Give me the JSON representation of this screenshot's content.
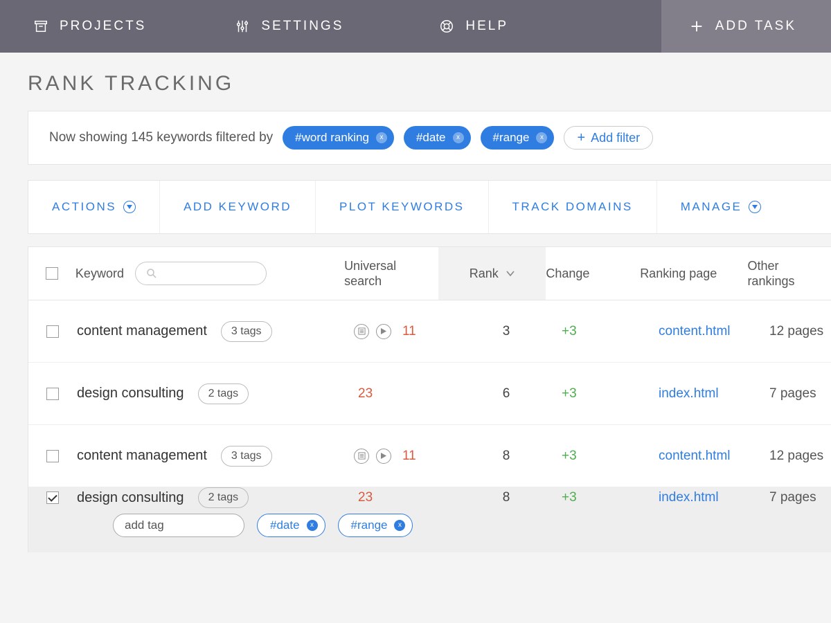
{
  "nav": {
    "projects": "PROJECTS",
    "settings": "SETTINGS",
    "help": "HELP",
    "add_task": "ADD TASK"
  },
  "page": {
    "title": "RANK TRACKING"
  },
  "filter": {
    "lead": "Now showing 145 keywords filtered by",
    "chips": [
      "#word ranking",
      "#date",
      "#range"
    ],
    "add": "Add filter"
  },
  "toolbar": {
    "actions": "ACTIONS",
    "add_keyword": "ADD KEYWORD",
    "plot": "PLOT KEYWORDS",
    "track": "TRACK DOMAINS",
    "manage": "MANAGE"
  },
  "columns": {
    "keyword": "Keyword",
    "universal": "Universal search",
    "rank": "Rank",
    "change": "Change",
    "ranking_page": "Ranking page",
    "other": "Other rankings"
  },
  "rows": [
    {
      "kw": "content management",
      "tags": "3 tags",
      "us_icons": true,
      "us_count": "11",
      "rank": "3",
      "change": "+3",
      "page": "content.html",
      "other": "12 pages",
      "selected": false
    },
    {
      "kw": "design consulting",
      "tags": "2 tags",
      "us_icons": false,
      "us_count": "23",
      "rank": "6",
      "change": "+3",
      "page": "index.html",
      "other": "7 pages",
      "selected": false
    },
    {
      "kw": "content management",
      "tags": "3 tags",
      "us_icons": true,
      "us_count": "11",
      "rank": "8",
      "change": "+3",
      "page": "content.html",
      "other": "12 pages",
      "selected": false
    },
    {
      "kw": "design consulting",
      "tags": "2 tags",
      "us_icons": false,
      "us_count": "23",
      "rank": "8",
      "change": "+3",
      "page": "index.html",
      "other": "7 pages",
      "selected": true,
      "sub": {
        "add_tag": "add tag",
        "chips": [
          "#date",
          "#range"
        ]
      }
    }
  ]
}
